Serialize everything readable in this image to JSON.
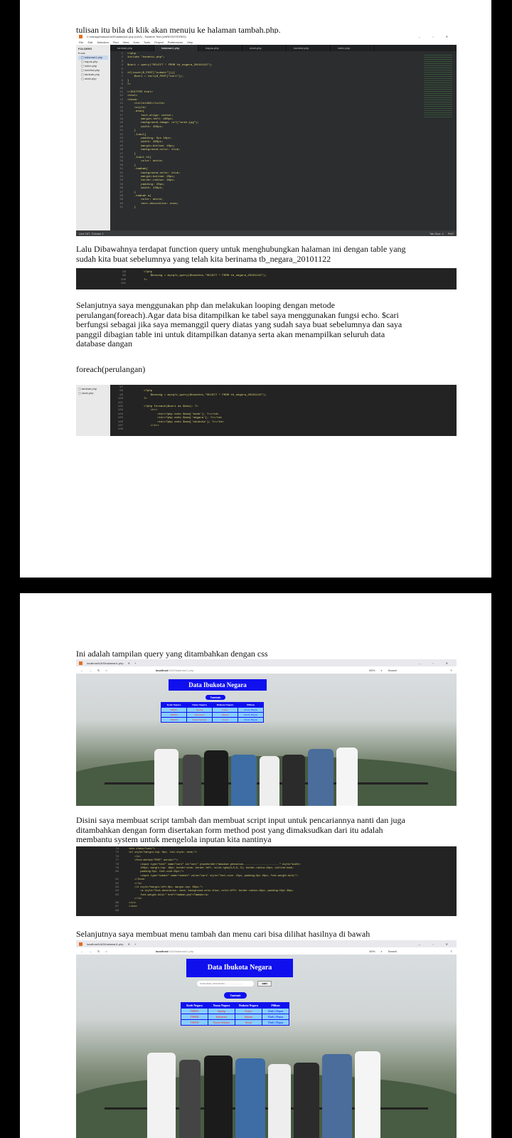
{
  "page1": {
    "para1": "tulisan itu bila di klik akan menuju ke halaman tambah.php.",
    "editor": {
      "title": "C:\\xampp\\htdocs\\UAS\\halaman1.php (UAS) - Sublime Text (UNREGISTERED)",
      "menu": [
        "File",
        "Edit",
        "Selection",
        "Find",
        "View",
        "Goto",
        "Tools",
        "Project",
        "Preferences",
        "Help"
      ],
      "folders_label": "FOLDERS",
      "files": [
        "uas",
        "halaman1.php",
        "hapus.php",
        "index.php",
        "koneksi.php",
        "tambah.php",
        "ubah.php"
      ],
      "tabs": [
        "tambah.php",
        "halaman1.php",
        "hapus.php",
        "ubah.php",
        "koneksi.php",
        "index.php"
      ],
      "line_numbers": "1\n2\n3\n4\n5\n6\n7\n8\n9\n10\n11\n12\n13\n14\n15\n16\n17\n18\n19\n20\n21\n22\n23\n24\n25\n26\n27\n28\n29\n30\n31\n32\n33\n34\n35\n36\n37\n38\n39\n40\n41",
      "code": "<?php\ninclude \"koneksi.php\";\n\n$cari = query(\"SELECT * FROM tb_negara_20101122\");\n\nif(isset($_POST[\"submit\"])){\n    $cari = cari($_POST[\"cari\"]);\n}\n?>\n\n<!DOCTYPE html>\n<html>\n<head>\n    <title>UAS</title>\n    <style>\n    .atas{\n        text-align: center;\n        margin-left: 400px;\n        background-image: url(\"arah.jpg\");\n        width: 400px;\n    }\n    .Judul{\n        padding: 5px 10px;\n        width: 380px;\n        margin-bottom: 10px;\n        background-color: blue;\n    }\n    .Judul h1{\n        color: white;\n    }\n    .tambah{\n        background-color: blue;\n        margin-bottom: 20px;\n        border-radius: 40px;\n        padding: 20px;\n        width: 130px;\n    }\n    .tambah a{\n        color: white;\n        text-decoration: none;\n    }",
      "status_left": "Line 167, Column 1",
      "status_right": "Tab Size: 4",
      "status_lang": "PHP"
    },
    "para2": "Lalu Dibawahnya terdapat function query untuk menghubungkan halaman ini dengan table  yang sudah kita buat sebelumnya yang telah kita berinama tb_negara_20101122",
    "snippet1": {
      "line_numbers": "98\n99\n100\n101",
      "code": "<?php\n    $kosong = mysqli_query($koneksi,\"SELECT * FROM tb_negara_20101122\");\n?>"
    },
    "para3": "Selanjutnya saya  menggunakan php dan melakukan looping dengan metode perulangan(foreach).Agar data bisa ditampilkan ke tabel saya menggunakan fungsi echo.  $cari berfungsi sebagai jika saya memanggil query diatas yang sudah  saya buat sebelumnya dan saya panggil dibagian table ini untuk ditampilkan  datanya serta akan menampilkan seluruh data database dangan",
    "para4": "foreach(perulangan)",
    "snippet2": {
      "files": [
        "tambah.php",
        "ubah.php"
      ],
      "line_numbers": "97\n98\n99\n100\n101\n102\n103\n104\n105\n106\n107\n108",
      "code": "\n<?php\n    $kosong = mysqli_query($koneksi,\"SELECT * FROM tb_negara_20101122\");\n?>\n\n<?php foreach($cari as $cea): ?>\n    <tr>\n        <td><?php echo $cea['kode']; ?></td>\n        <td><?php echo $cea['negara']; ?></td>\n        <td><?php echo $cea['ibukota']; ?></td>\n    </tr>"
    }
  },
  "page2": {
    "para1": "Ini adalah tampilan query  yang ditambahkan dengan css",
    "browser1": {
      "tab_title": "localhost/UAS/halaman1.php",
      "url_host": "localhost",
      "url_path": "/UAS/halaman1.php",
      "zoom": "80%",
      "search": "Search"
    },
    "app": {
      "title": "Data Ibukota Negara",
      "tambah": "Tambah",
      "search_placeholder": "masukan pencarian.......................",
      "cari": "cari",
      "headers": [
        "Kode Negara",
        "Nama Negara",
        "Ibukota Negara",
        "Pilihan"
      ],
      "rows": [
        {
          "kode": "TM001",
          "negara": "Jepang",
          "ibukota": "Tokyo",
          "pilihan": "Ubah | Hapus"
        },
        {
          "kode": "TM002",
          "negara": "Indonesia",
          "ibukota": "Jakarta",
          "pilihan": "Ubah | Hapus"
        },
        {
          "kode": "TM100",
          "negara": "Korea Selatan",
          "ibukota": "Seoul",
          "pilihan": "Ubah | Hapus"
        }
      ]
    },
    "para2": "Disini saya membuat script tambah dan membuat script input untuk pencariannya nanti dan juga ditambahkan dengan form disertakan form method  post yang dimaksudkan dari itu adalah membantu system untuk mengelola  inputan kita nantinya",
    "snippet3": {
      "line_numbers": "74\n75\n76\n77\n78\n79\n80\n\n81\n82\n83\n84\n85\n\n86\n87\n88",
      "code": "    <div class=\"cari\">\n    <ul style=\"margin-top: 0px; list-style: none;\">\n        <li>\n        <form method=\"POST\" action=\"\">\n            <input type=\"text\" name=\"cari\" id=\"cari\" placeholder=\"masukan pencarian.........................\" style=\"width:\n            150px; margin-top: 10px; border:none; border-left: solid rgba(0,0,0,.5); border-radius:10px; outline:none;\n            padding:5px; font-size:15px;\">\n            <input type=\"submit\" name=\"submit\" value=\"cari\" style=\"font-size: 15px; padding:5px 10px; font-weight:bold;\">\n        </form>\n        </li>\n        <li style=\"margin-left:0px; margin-top: 80px;\">\n            <a style=\"text-decoration: none; background-color:blue; color:#fff; border-radius:10px; padding:10px 30px;\n            font-weight:bold;\" href=\"tambah.php\">Tambah</a>\n        </li>\n    </ul>\n    </div>"
    },
    "para3": "Selanjutnya saya membuat menu tambah dan menu cari bisa dilihat hasilnya di bawah",
    "browser2": {
      "tab_title": "localhost/UAS/halaman1.php",
      "url_host": "localhost",
      "url_path": "/UAS/halaman1.php",
      "zoom": "80%",
      "search": "Search"
    },
    "colors": {
      "accent": "#1010ee",
      "cell": "#87cefa",
      "code_bg": "#2b2d2f"
    }
  }
}
